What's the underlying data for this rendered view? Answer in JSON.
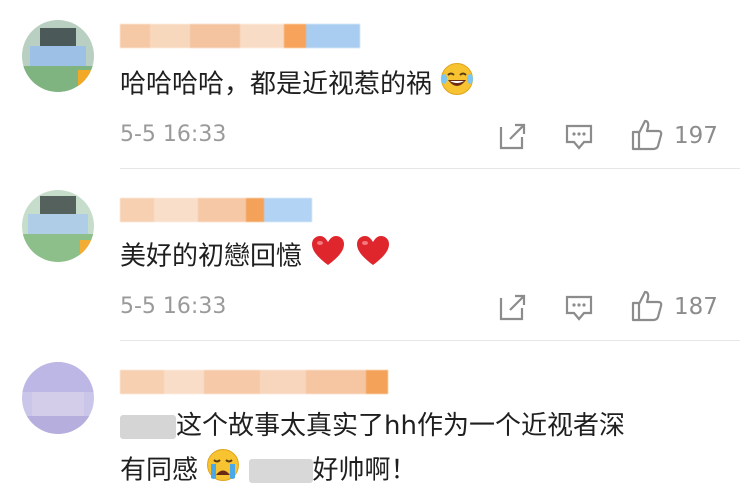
{
  "comments": [
    {
      "text": "哈哈哈哈，都是近视惹的祸",
      "emoji": "laughing-with-tears",
      "time": "5-5 16:33",
      "likes": "197"
    },
    {
      "text": "美好的初戀回憶",
      "emoji": "red-heart",
      "time": "5-5 16:33",
      "likes": "187"
    },
    {
      "text_line1": "这个故事太真实了hh作为一个近视者深",
      "text_line2_a": "有同感",
      "text_line2_b": "好帅啊！",
      "emoji": "crying-face"
    }
  ],
  "colors": {
    "meta_gray": "#9a9a9a",
    "icon_gray": "#8c8c8c",
    "heart_red": "#e0262d",
    "divider": "#e6e6e6"
  },
  "icons": [
    "share-icon",
    "comment-icon",
    "like-icon"
  ]
}
